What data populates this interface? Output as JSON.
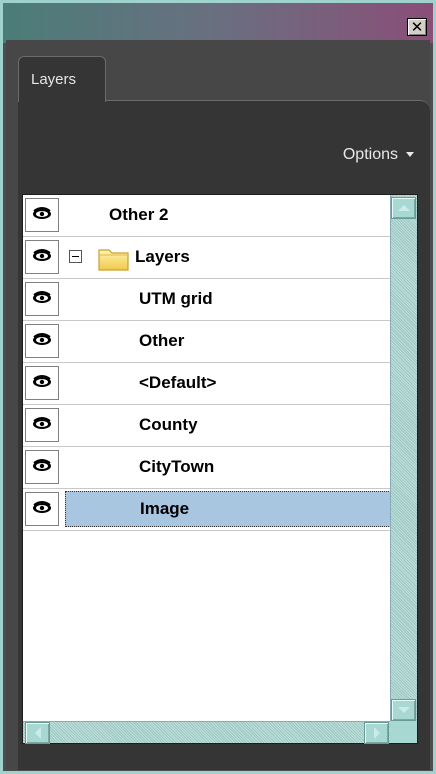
{
  "panel": {
    "tab_label": "Layers",
    "options_label": "Options",
    "close_symbol": "✕"
  },
  "layers": [
    {
      "label": "Other 2",
      "indent": 0,
      "selected": false
    },
    {
      "label": "Layers",
      "indent": 0,
      "group": true,
      "expanded": true,
      "selected": false
    },
    {
      "label": "UTM grid",
      "indent": 1,
      "selected": false
    },
    {
      "label": "Other",
      "indent": 1,
      "selected": false
    },
    {
      "label": "<Default>",
      "indent": 1,
      "selected": false
    },
    {
      "label": "County",
      "indent": 1,
      "selected": false
    },
    {
      "label": "CityTown",
      "indent": 1,
      "selected": false
    },
    {
      "label": "Image",
      "indent": 1,
      "selected": true
    }
  ],
  "icons": {
    "visibility": "eye-icon",
    "group": "folder-icon",
    "expander": "collapse-icon"
  },
  "colors": {
    "selection": "#a9c6e0",
    "panel": "#353535",
    "titlebar_left": "#4b7d78",
    "titlebar_right": "#8a4e78"
  }
}
